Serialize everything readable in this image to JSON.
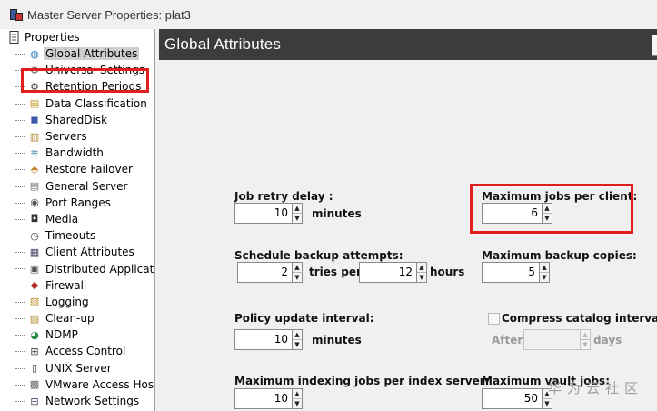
{
  "window": {
    "title": "Master Server Properties: plat3"
  },
  "tree": {
    "root_label": "Properties",
    "items": [
      {
        "label": "Global Attributes",
        "icon": "globe-icon",
        "selected": true
      },
      {
        "label": "Universal Settings",
        "icon": "settings-icon"
      },
      {
        "label": "Retention Periods",
        "icon": "retention-icon"
      },
      {
        "label": "Data Classification",
        "icon": "data-classification-icon"
      },
      {
        "label": "SharedDisk",
        "icon": "shared-disk-icon"
      },
      {
        "label": "Servers",
        "icon": "servers-icon"
      },
      {
        "label": "Bandwidth",
        "icon": "bandwidth-icon"
      },
      {
        "label": "Restore Failover",
        "icon": "restore-failover-icon"
      },
      {
        "label": "General Server",
        "icon": "server-icon"
      },
      {
        "label": "Port Ranges",
        "icon": "port-icon"
      },
      {
        "label": "Media",
        "icon": "media-icon"
      },
      {
        "label": "Timeouts",
        "icon": "clock-icon"
      },
      {
        "label": "Client Attributes",
        "icon": "client-icon"
      },
      {
        "label": "Distributed Applicati",
        "icon": "distributed-app-icon"
      },
      {
        "label": "Firewall",
        "icon": "firewall-icon"
      },
      {
        "label": "Logging",
        "icon": "logging-icon"
      },
      {
        "label": "Clean-up",
        "icon": "cleanup-icon"
      },
      {
        "label": "NDMP",
        "icon": "ndmp-icon"
      },
      {
        "label": "Access Control",
        "icon": "access-control-icon"
      },
      {
        "label": "UNIX Server",
        "icon": "unix-server-icon"
      },
      {
        "label": "VMware Access Host",
        "icon": "vmware-icon"
      },
      {
        "label": "Network Settings",
        "icon": "network-icon"
      }
    ]
  },
  "panel": {
    "title": "Global Attributes",
    "job_retry_delay": {
      "label": "Job retry delay :",
      "value": "10",
      "unit": "minutes"
    },
    "max_jobs_per_client": {
      "label": "Maximum jobs per client:",
      "value": "6"
    },
    "schedule_backup_attempts": {
      "label": "Schedule backup attempts:",
      "tries_value": "2",
      "tries_unit": "tries per",
      "hours_value": "12",
      "hours_unit": "hours"
    },
    "max_backup_copies": {
      "label": "Maximum backup copies:",
      "value": "5"
    },
    "policy_update_interval": {
      "label": "Policy update interval:",
      "value": "10",
      "unit": "minutes"
    },
    "compress_catalog": {
      "label": "Compress catalog interval",
      "checked": false,
      "after_label": "After",
      "value": "",
      "unit": "days"
    },
    "max_indexing_jobs": {
      "label": "Maximum indexing jobs per index server:",
      "value": "10"
    },
    "max_vault_jobs": {
      "label": "Maximum vault jobs:",
      "value": "50"
    }
  },
  "watermark": "华为云社区",
  "colors": {
    "highlight_border": "#e0201e",
    "header_bg": "#3c3c3c",
    "selected_bg": "#cfcfcf"
  }
}
